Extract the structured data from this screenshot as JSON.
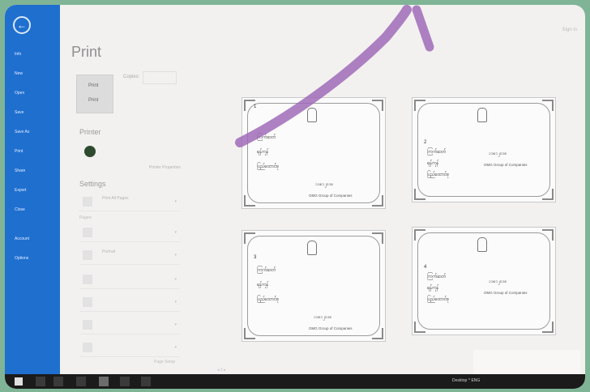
{
  "window": {
    "title": "",
    "sign_in": "Sign in"
  },
  "backstage": {
    "back_glyph": "←",
    "items": [
      {
        "label": "Info"
      },
      {
        "label": "New"
      },
      {
        "label": "Open"
      },
      {
        "label": "Save"
      },
      {
        "label": "Save As"
      },
      {
        "label": "Print"
      },
      {
        "label": "Share"
      },
      {
        "label": "Export"
      },
      {
        "label": "Close"
      },
      {
        "label": "Account"
      },
      {
        "label": "Options"
      }
    ]
  },
  "print": {
    "heading": "Print",
    "print_button_top": "Print",
    "print_button_label": "Print",
    "copies_label": "Copies:",
    "printer_heading": "Printer",
    "printer_name": "",
    "printer_status": "",
    "printer_properties": "Printer Properties",
    "settings_heading": "Settings",
    "settings": [
      {
        "line1": "Print All Pages",
        "line2": "",
        "dropdown": "▾"
      },
      {
        "line1": "",
        "line2": "",
        "dropdown": "▾"
      },
      {
        "line1": "Portrait",
        "line2": "",
        "dropdown": "▾"
      },
      {
        "line1": "",
        "line2": "",
        "dropdown": "▾"
      },
      {
        "line1": "",
        "line2": "",
        "dropdown": "▾"
      },
      {
        "line1": "",
        "line2": "",
        "dropdown": "▾"
      },
      {
        "line1": "",
        "line2": "",
        "dropdown": "▾"
      }
    ],
    "pages_label": "Pages:",
    "page_setup": "Page Setup"
  },
  "preview": {
    "cards": [
      {
        "num": "1",
        "l1": "ကြက်ဆတ်",
        "l2": "ရန်ကုန်",
        "l3": "ပြည်ထောင်စု",
        "date": "၁၁၈၁၂၀၁၈",
        "org": "OMG Group of Companies"
      },
      {
        "num": "2",
        "l1": "ကြက်ဆတ်",
        "l2": "ရန်ကုန်",
        "l3": "ပြည်ထောင်စု",
        "date": "၁၁၈၁၂၀၁၈",
        "org": "OMG Group of Companies"
      },
      {
        "num": "3",
        "l1": "ကြက်ဆတ်",
        "l2": "ရန်ကုန်",
        "l3": "ပြည်ထောင်စု",
        "date": "၁၁၈၁၂၀၁၈",
        "org": "OMG Group of Companies"
      },
      {
        "num": "4",
        "l1": "ကြက်ဆတ်",
        "l2": "ရန်ကုန်",
        "l3": "ပြည်ထောင်စု",
        "date": "၁၁၈၁၂၀၁၈",
        "org": "OMG Group of Companies"
      }
    ],
    "page_nav": "◂  1  ▸"
  },
  "taskbar": {
    "tray": "Desktop  ^  ENG",
    "clock_time": "",
    "clock_date": ""
  },
  "colors": {
    "accent": "#1f6fcf",
    "annotation": "#a06bb8"
  }
}
